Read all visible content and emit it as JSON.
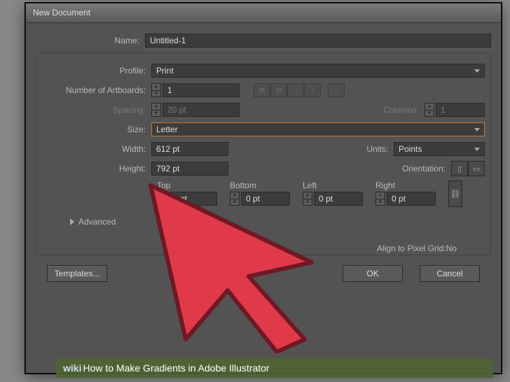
{
  "window": {
    "title": "New Document"
  },
  "fields": {
    "name_label": "Name:",
    "name_value": "Untitled-1",
    "profile_label": "Profile:",
    "profile_value": "Print",
    "artboards_label": "Number of Artboards:",
    "artboards_value": "1",
    "spacing_label": "Spacing:",
    "spacing_value": "20 pt",
    "columns_label": "Columns:",
    "columns_value": "1",
    "size_label": "Size:",
    "size_value": "Letter",
    "width_label": "Width:",
    "width_value": "612 pt",
    "height_label": "Height:",
    "height_value": "792 pt",
    "units_label": "Units:",
    "units_value": "Points",
    "orientation_label": "Orientation:"
  },
  "bleed": {
    "top_label": "Top",
    "top_value": "0 pt",
    "bottom_label": "Bottom",
    "bottom_value": "0 pt",
    "left_label": "Left",
    "left_value": "0 pt",
    "right_label": "Right",
    "right_value": "0 pt"
  },
  "advanced_label": "Advanced",
  "pixel_grid": "Align to Pixel Grid:No",
  "buttons": {
    "templates": "Templates...",
    "ok": "OK",
    "cancel": "Cancel"
  },
  "overlay": {
    "wiki_prefix": "wiki",
    "wiki_title": "How to Make Gradients in Adobe Illustrator"
  }
}
